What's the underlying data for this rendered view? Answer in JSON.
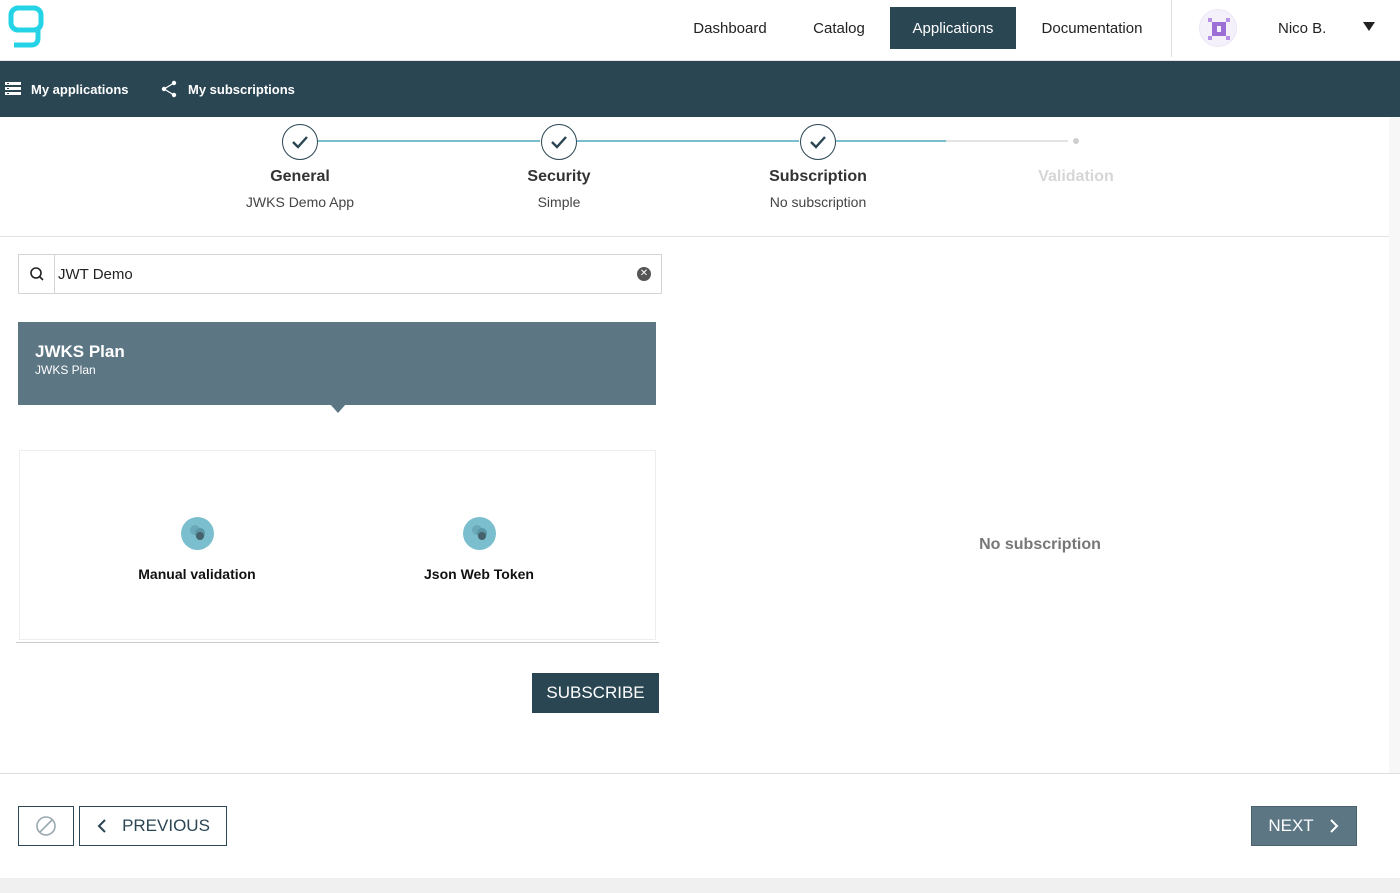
{
  "nav": {
    "items": [
      {
        "label": "Dashboard",
        "active": false
      },
      {
        "label": "Catalog",
        "active": false
      },
      {
        "label": "Applications",
        "active": true
      },
      {
        "label": "Documentation",
        "active": false
      }
    ],
    "user": {
      "name": "Nico B."
    }
  },
  "subnav": {
    "my_applications": "My applications",
    "my_subscriptions": "My subscriptions"
  },
  "stepper": {
    "steps": [
      {
        "title": "General",
        "subtitle": "JWKS Demo App",
        "done": true
      },
      {
        "title": "Security",
        "subtitle": "Simple",
        "done": true
      },
      {
        "title": "Subscription",
        "subtitle": "No subscription",
        "done": true
      },
      {
        "title": "Validation",
        "subtitle": "",
        "done": false
      }
    ]
  },
  "search": {
    "value": "JWT Demo"
  },
  "plan": {
    "name": "JWKS Plan",
    "description": "JWKS Plan"
  },
  "security_types": [
    {
      "label": "Manual validation"
    },
    {
      "label": "Json Web Token"
    }
  ],
  "subscribe_label": "SUBSCRIBE",
  "empty_state": "No subscription",
  "footer": {
    "previous_label": "PREVIOUS",
    "next_label": "NEXT"
  },
  "colors": {
    "primary": "#2b4653",
    "secondary": "#5c7684",
    "accent": "#7bbfcf",
    "logo": "#24d4e6"
  }
}
